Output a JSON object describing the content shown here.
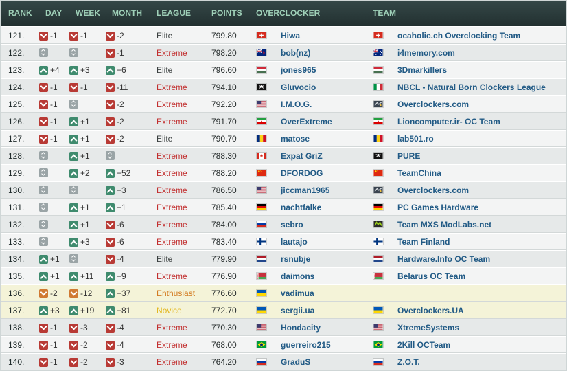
{
  "columns": {
    "rank": "RANK",
    "day": "DAY",
    "week": "WEEK",
    "month": "MONTH",
    "league": "LEAGUE",
    "points": "POINTS",
    "overclocker": "OVERCLOCKER",
    "team": "TEAM"
  },
  "league_colors": {
    "Elite": "#3a3f3f",
    "Extreme": "#c22f2f",
    "Enthusiast": "#d37b21",
    "Novice": "#e3b820"
  },
  "rows": [
    {
      "rank": "121.",
      "day": {
        "dir": "down",
        "delta": "-1"
      },
      "week": {
        "dir": "down",
        "delta": "-1"
      },
      "month": {
        "dir": "down",
        "delta": "-2"
      },
      "league": "Elite",
      "points": "799.80",
      "oc_flag": "switzerland-flag",
      "overclocker": "Hiwa",
      "team_flag": "switzerland-flag",
      "team": "ocaholic.ch Overclocking Team"
    },
    {
      "rank": "122.",
      "day": {
        "dir": "same",
        "delta": ""
      },
      "week": {
        "dir": "same",
        "delta": ""
      },
      "month": {
        "dir": "down",
        "delta": "-1"
      },
      "league": "Extreme",
      "points": "798.20",
      "oc_flag": "new-zealand-flag",
      "overclocker": "bob(nz)",
      "team_flag": "australia-flag",
      "team": "i4memory.com"
    },
    {
      "rank": "123.",
      "day": {
        "dir": "up",
        "delta": "+4"
      },
      "week": {
        "dir": "up",
        "delta": "+3"
      },
      "month": {
        "dir": "up",
        "delta": "+6"
      },
      "league": "Elite",
      "points": "796.60",
      "oc_flag": "hungary-flag",
      "overclocker": "jones965",
      "team_flag": "hungary-flag",
      "team": "3Dmarkillers"
    },
    {
      "rank": "124.",
      "day": {
        "dir": "down",
        "delta": "-1"
      },
      "week": {
        "dir": "down",
        "delta": "-1"
      },
      "month": {
        "dir": "down",
        "delta": "-11"
      },
      "league": "Extreme",
      "points": "794.10",
      "oc_flag": "pirate-flag",
      "overclocker": "Gluvocio",
      "team_flag": "italy-flag",
      "team": "NBCL - Natural Born Clockers League"
    },
    {
      "rank": "125.",
      "day": {
        "dir": "down",
        "delta": "-1"
      },
      "week": {
        "dir": "same",
        "delta": ""
      },
      "month": {
        "dir": "down",
        "delta": "-2"
      },
      "league": "Extreme",
      "points": "792.20",
      "oc_flag": "usa-flag",
      "overclocker": "I.M.O.G.",
      "team_flag": "team-logo-flag",
      "team": "Overclockers.com"
    },
    {
      "rank": "126.",
      "day": {
        "dir": "down",
        "delta": "-1"
      },
      "week": {
        "dir": "up",
        "delta": "+1"
      },
      "month": {
        "dir": "down",
        "delta": "-2"
      },
      "league": "Extreme",
      "points": "791.70",
      "oc_flag": "iran-flag",
      "overclocker": "OverExtreme",
      "team_flag": "iran-flag",
      "team": "Lioncomputer.ir- OC Team"
    },
    {
      "rank": "127.",
      "day": {
        "dir": "down",
        "delta": "-1"
      },
      "week": {
        "dir": "up",
        "delta": "+1"
      },
      "month": {
        "dir": "down",
        "delta": "-2"
      },
      "league": "Elite",
      "points": "790.70",
      "oc_flag": "romania-flag",
      "overclocker": "matose",
      "team_flag": "romania-flag",
      "team": "lab501.ro"
    },
    {
      "rank": "128.",
      "day": {
        "dir": "same",
        "delta": ""
      },
      "week": {
        "dir": "up",
        "delta": "+1"
      },
      "month": {
        "dir": "same",
        "delta": ""
      },
      "league": "Extreme",
      "points": "788.30",
      "oc_flag": "canada-flag",
      "overclocker": "Expat GriZ",
      "team_flag": "pirate-flag",
      "team": "PURE"
    },
    {
      "rank": "129.",
      "day": {
        "dir": "same",
        "delta": ""
      },
      "week": {
        "dir": "up",
        "delta": "+2"
      },
      "month": {
        "dir": "up",
        "delta": "+52"
      },
      "league": "Extreme",
      "points": "788.20",
      "oc_flag": "china-flag",
      "overclocker": "DFORDOG",
      "team_flag": "china-flag",
      "team": "TeamChina"
    },
    {
      "rank": "130.",
      "day": {
        "dir": "same",
        "delta": ""
      },
      "week": {
        "dir": "same",
        "delta": ""
      },
      "month": {
        "dir": "up",
        "delta": "+3"
      },
      "league": "Extreme",
      "points": "786.50",
      "oc_flag": "usa-flag",
      "overclocker": "jiccman1965",
      "team_flag": "team-logo-flag",
      "team": "Overclockers.com"
    },
    {
      "rank": "131.",
      "day": {
        "dir": "same",
        "delta": ""
      },
      "week": {
        "dir": "up",
        "delta": "+1"
      },
      "month": {
        "dir": "up",
        "delta": "+1"
      },
      "league": "Extreme",
      "points": "785.40",
      "oc_flag": "germany-flag",
      "overclocker": "nachtfalke",
      "team_flag": "germany-flag",
      "team": "PC Games Hardware"
    },
    {
      "rank": "132.",
      "day": {
        "dir": "same",
        "delta": ""
      },
      "week": {
        "dir": "up",
        "delta": "+1"
      },
      "month": {
        "dir": "down",
        "delta": "-6"
      },
      "league": "Extreme",
      "points": "784.00",
      "oc_flag": "russia-flag",
      "overclocker": "sebro",
      "team_flag": "modlabs-flag",
      "team": "Team MXS ModLabs.net"
    },
    {
      "rank": "133.",
      "day": {
        "dir": "same",
        "delta": ""
      },
      "week": {
        "dir": "up",
        "delta": "+3"
      },
      "month": {
        "dir": "down",
        "delta": "-6"
      },
      "league": "Extreme",
      "points": "783.40",
      "oc_flag": "finland-flag",
      "overclocker": "lautajo",
      "team_flag": "finland-flag",
      "team": "Team Finland"
    },
    {
      "rank": "134.",
      "day": {
        "dir": "up",
        "delta": "+1"
      },
      "week": {
        "dir": "same",
        "delta": ""
      },
      "month": {
        "dir": "down",
        "delta": "-4"
      },
      "league": "Elite",
      "points": "779.90",
      "oc_flag": "netherlands-flag",
      "overclocker": "rsnubje",
      "team_flag": "netherlands-flag",
      "team": "Hardware.Info OC Team"
    },
    {
      "rank": "135.",
      "day": {
        "dir": "up",
        "delta": "+1"
      },
      "week": {
        "dir": "up",
        "delta": "+11"
      },
      "month": {
        "dir": "up",
        "delta": "+9"
      },
      "league": "Extreme",
      "points": "776.90",
      "oc_flag": "belarus-flag",
      "overclocker": "daimons",
      "team_flag": "belarus-flag",
      "team": "Belarus OC Team"
    },
    {
      "rank": "136.",
      "day": {
        "dir": "down-orange",
        "delta": "-2"
      },
      "week": {
        "dir": "down-orange",
        "delta": "-12"
      },
      "month": {
        "dir": "up",
        "delta": "+37"
      },
      "league": "Enthusiast",
      "points": "776.60",
      "oc_flag": "ukraine-flag",
      "overclocker": "vadimua",
      "team_flag": "",
      "team": "",
      "highlight": true
    },
    {
      "rank": "137.",
      "day": {
        "dir": "up",
        "delta": "+3"
      },
      "week": {
        "dir": "up",
        "delta": "+19"
      },
      "month": {
        "dir": "up",
        "delta": "+81"
      },
      "league": "Novice",
      "points": "772.70",
      "oc_flag": "ukraine-flag",
      "overclocker": "sergii.ua",
      "team_flag": "ukraine-flag",
      "team": "Overclockers.UA",
      "highlight": true
    },
    {
      "rank": "138.",
      "day": {
        "dir": "down",
        "delta": "-1"
      },
      "week": {
        "dir": "down",
        "delta": "-3"
      },
      "month": {
        "dir": "down",
        "delta": "-4"
      },
      "league": "Extreme",
      "points": "770.30",
      "oc_flag": "usa-flag",
      "overclocker": "Hondacity",
      "team_flag": "usa-flag",
      "team": "XtremeSystems"
    },
    {
      "rank": "139.",
      "day": {
        "dir": "down",
        "delta": "-1"
      },
      "week": {
        "dir": "down",
        "delta": "-2"
      },
      "month": {
        "dir": "down",
        "delta": "-4"
      },
      "league": "Extreme",
      "points": "768.00",
      "oc_flag": "brazil-flag",
      "overclocker": "guerreiro215",
      "team_flag": "brazil-flag",
      "team": "2Kill OCTeam"
    },
    {
      "rank": "140.",
      "day": {
        "dir": "down",
        "delta": "-1"
      },
      "week": {
        "dir": "down",
        "delta": "-2"
      },
      "month": {
        "dir": "down",
        "delta": "-3"
      },
      "league": "Extreme",
      "points": "764.20",
      "oc_flag": "russia-flag",
      "overclocker": "GraduS",
      "team_flag": "russia-flag",
      "team": "Z.O.T."
    }
  ]
}
